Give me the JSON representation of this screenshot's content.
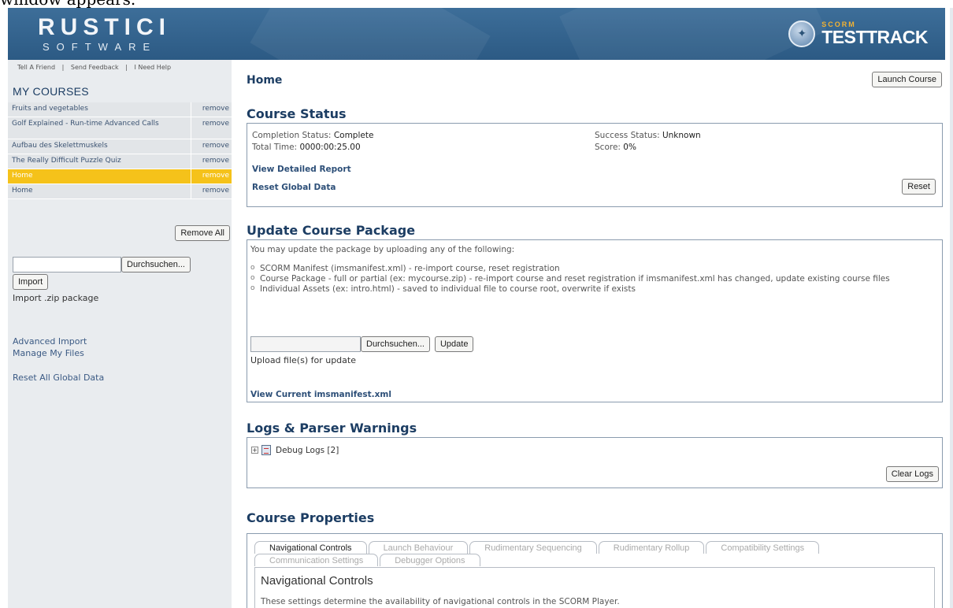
{
  "caption": "window appears.",
  "header": {
    "logo_main": "RUSTICI",
    "logo_sub": "SOFTWARE",
    "brand_small": "SCORM",
    "brand_large": "TESTTRACK"
  },
  "sidebar": {
    "links": [
      "Tell A Friend",
      "Send Feedback",
      "I Need Help"
    ],
    "separator": "|",
    "my_courses_title": "MY COURSES",
    "courses": [
      {
        "name": "Fruits and vegetables",
        "action": "remove"
      },
      {
        "name": "Golf Explained - Run-time Advanced Calls",
        "action": "remove"
      },
      {
        "name": "Aufbau des Skelettmuskels",
        "action": "remove"
      },
      {
        "name": "The Really Difficult Puzzle Quiz",
        "action": "remove"
      },
      {
        "name": "Home",
        "action": "remove"
      },
      {
        "name": "Home",
        "action": "remove"
      }
    ],
    "remove_all": "Remove All",
    "browse": "Durchsuchen...",
    "import_button": "Import",
    "import_label": "Import .zip package",
    "advanced_import": "Advanced Import",
    "manage_files": "Manage My Files",
    "reset_all": "Reset All Global Data"
  },
  "main": {
    "page_title": "Home",
    "launch_button": "Launch Course",
    "course_status": {
      "title": "Course Status",
      "completion_label": "Completion Status:",
      "completion_value": "Complete",
      "total_time_label": "Total Time:",
      "total_time_value": "0000:00:25.00",
      "success_label": "Success Status:",
      "success_value": "Unknown",
      "score_label": "Score:",
      "score_value": "0%",
      "view_report": "View Detailed Report",
      "reset_global": "Reset Global Data",
      "reset_button": "Reset"
    },
    "update_package": {
      "title": "Update Course Package",
      "intro": "You may update the package by uploading any of the following:",
      "items": [
        "SCORM Manifest (imsmanifest.xml) - re-import course, reset registration",
        "Course Package - full or partial (ex: mycourse.zip) - re-import course and reset registration if imsmanifest.xml has changed, update existing course files",
        "Individual Assets (ex: intro.html) - saved to individual file to course root, overwrite if exists"
      ],
      "browse": "Durchsuchen...",
      "update_button": "Update",
      "upload_label": "Upload file(s) for update",
      "view_manifest": "View Current imsmanifest.xml"
    },
    "logs": {
      "title": "Logs & Parser Warnings",
      "expand": "+",
      "debug_logs": "Debug Logs [2]",
      "clear_button": "Clear Logs"
    },
    "properties": {
      "title": "Course Properties",
      "tabs_row1": [
        "Navigational Controls",
        "Launch Behaviour",
        "Rudimentary Sequencing",
        "Rudimentary Rollup",
        "Compatibility Settings"
      ],
      "tabs_row2": [
        "Communication Settings",
        "Debugger Options"
      ],
      "panel_title": "Navigational Controls",
      "panel_desc": "These settings determine the availability of navigational controls in the SCORM Player."
    }
  }
}
